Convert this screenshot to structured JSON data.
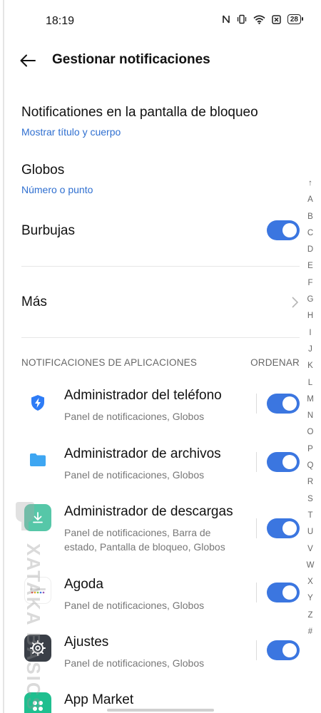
{
  "status_bar": {
    "time": "18:19",
    "battery": "28"
  },
  "header": {
    "title": "Gestionar notificaciones"
  },
  "settings": {
    "lock_screen": {
      "title": "Notificationes en la pantalla de bloqueo",
      "value": "Mostrar título y cuerpo"
    },
    "badges": {
      "title": "Globos",
      "value": "Número o punto"
    },
    "bubbles": {
      "title": "Burbujas",
      "enabled": true
    },
    "more": {
      "title": "Más"
    }
  },
  "apps_section": {
    "label": "NOTIFICACIONES DE APLICACIONES",
    "action": "ORDENAR",
    "apps": [
      {
        "name": "Administrador del teléfono",
        "desc": "Panel de notificaciones, Globos",
        "enabled": true,
        "icon": "shield-bolt-icon",
        "color": "#2e7cf6"
      },
      {
        "name": "Administrador de archivos",
        "desc": "Panel de notificaciones, Globos",
        "enabled": true,
        "icon": "folder-icon",
        "color": "#3ea6f2"
      },
      {
        "name": "Administrador de descargas",
        "desc": "Panel de notificaciones, Barra de estado, Pantalla de bloqueo, Globos",
        "enabled": true,
        "icon": "download-icon",
        "color": "#56c7a8"
      },
      {
        "name": "Agoda",
        "desc": "Panel de notificaciones, Globos",
        "enabled": true,
        "icon": "agoda-logo-icon",
        "color": "#ffffff"
      },
      {
        "name": "Ajustes",
        "desc": "Panel de notificaciones, Globos",
        "enabled": true,
        "icon": "gear-icon",
        "color": "#3a3f47"
      },
      {
        "name": "App Market",
        "desc": "",
        "enabled": true,
        "icon": "app-market-icon",
        "color": "#1fbf8f"
      }
    ]
  },
  "alphabet_index": [
    "↑",
    "A",
    "B",
    "C",
    "D",
    "E",
    "F",
    "G",
    "H",
    "I",
    "J",
    "K",
    "L",
    "M",
    "N",
    "O",
    "P",
    "Q",
    "R",
    "S",
    "T",
    "U",
    "V",
    "W",
    "X",
    "Y",
    "Z",
    "#"
  ],
  "watermark": {
    "text": "XATAKA BASICS"
  },
  "colors": {
    "accent": "#3b76e0",
    "link": "#2f6fd0"
  }
}
